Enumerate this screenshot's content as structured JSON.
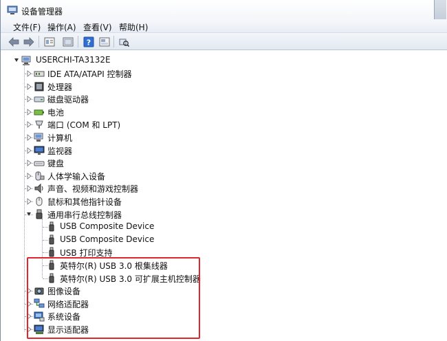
{
  "window": {
    "title": "设备管理器"
  },
  "menu": [
    {
      "label": "文件(F)"
    },
    {
      "label": "操作(A)"
    },
    {
      "label": "查看(V)"
    },
    {
      "label": "帮助(H)"
    }
  ],
  "toolbar": {
    "icons": [
      "back-arrow-icon",
      "forward-arrow-icon",
      "properties-icon",
      "view-icon",
      "help-icon",
      "view-hidden-icon",
      "scan-hardware-icon"
    ]
  },
  "tree": {
    "root": "USERCHI-TA3132E",
    "categories": [
      {
        "label": "IDE ATA/ATAPI 控制器",
        "icon": "ide-controller-icon"
      },
      {
        "label": "处理器",
        "icon": "processor-icon"
      },
      {
        "label": "磁盘驱动器",
        "icon": "disk-drive-icon"
      },
      {
        "label": "电池",
        "icon": "battery-icon"
      },
      {
        "label": "端口 (COM 和 LPT)",
        "icon": "port-icon"
      },
      {
        "label": "计算机",
        "icon": "computer-icon"
      },
      {
        "label": "监视器",
        "icon": "monitor-icon"
      },
      {
        "label": "键盘",
        "icon": "keyboard-icon"
      },
      {
        "label": "人体学输入设备",
        "icon": "hid-icon"
      },
      {
        "label": "声音、视频和游戏控制器",
        "icon": "sound-icon"
      },
      {
        "label": "鼠标和其他指针设备",
        "icon": "mouse-icon"
      },
      {
        "label": "通用串行总线控制器",
        "icon": "usb-icon",
        "expanded": true,
        "children": [
          {
            "label": "USB Composite Device"
          },
          {
            "label": "USB Composite Device"
          },
          {
            "label": "USB 打印支持"
          },
          {
            "label": "英特尔(R) USB 3.0 根集线器"
          },
          {
            "label": "英特尔(R) USB 3.0 可扩展主机控制器"
          }
        ]
      },
      {
        "label": "图像设备",
        "icon": "imaging-icon"
      },
      {
        "label": "网络适配器",
        "icon": "network-icon"
      },
      {
        "label": "系统设备",
        "icon": "system-device-icon"
      },
      {
        "label": "显示适配器",
        "icon": "display-adapter-icon"
      }
    ]
  },
  "colors": {
    "highlight_border": "#e0262c",
    "accent": "#3a73c6"
  }
}
